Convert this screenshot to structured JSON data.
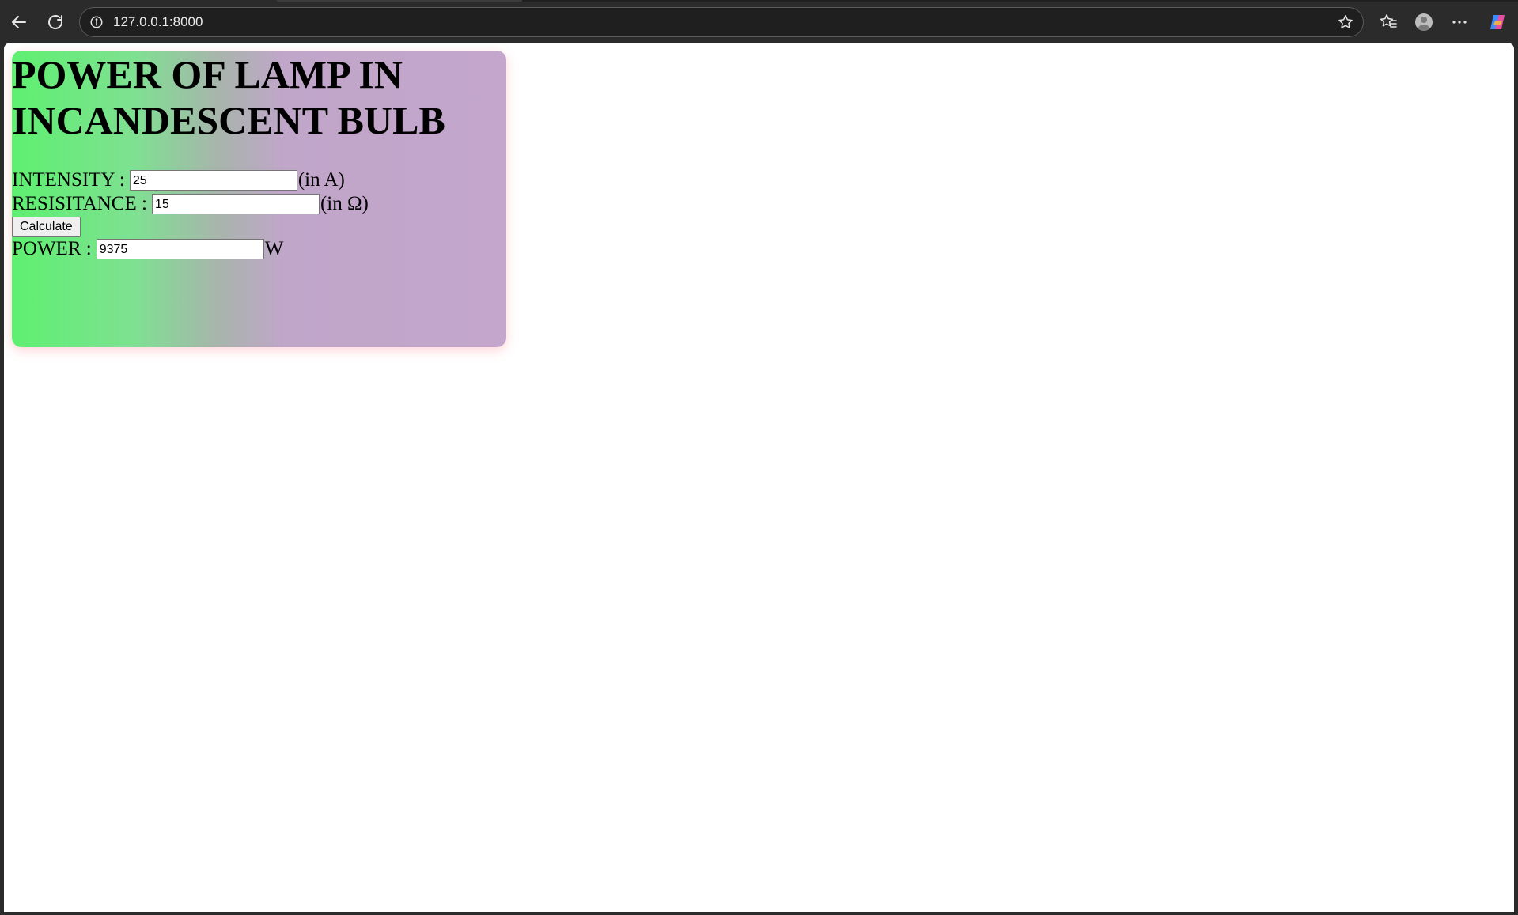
{
  "browser": {
    "url": "127.0.0.1:8000"
  },
  "page": {
    "title": "POWER OF LAMP IN INCANDESCENT BULB",
    "intensity": {
      "label": "INTENSITY :",
      "value": "25",
      "unit": "(in A)"
    },
    "resistance": {
      "label": "RESISITANCE :",
      "value": "15",
      "unit": "(in Ω)"
    },
    "calculate_label": "Calculate",
    "power": {
      "label": "POWER :",
      "value": "9375",
      "unit": "W"
    }
  },
  "colors": {
    "gradient_start": "#5ef070",
    "gradient_end": "#c4a6cc"
  },
  "icons": [
    "back-icon",
    "reload-icon",
    "info-icon",
    "star-icon",
    "favorites-icon",
    "profile-icon",
    "more-icon",
    "copilot-icon"
  ]
}
